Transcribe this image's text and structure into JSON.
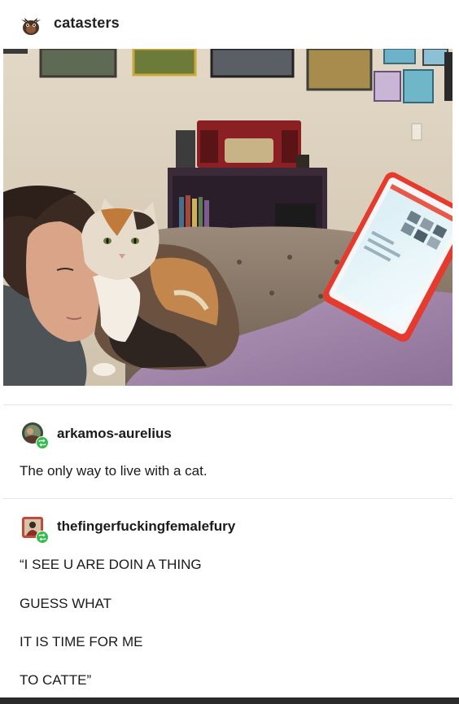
{
  "post": {
    "blog_name": "catasters",
    "blog_avatar_icon": "bat-creature-icon"
  },
  "reblogs": [
    {
      "username": "arkamos-aurelius",
      "avatar_icon": "user-avatar-icon",
      "badge_icon": "reblog-icon",
      "lines": [
        "The only way to live with a cat."
      ]
    },
    {
      "username": "thefingerfuckingfemalefury",
      "avatar_icon": "user-avatar-icon",
      "badge_icon": "reblog-icon",
      "lines": [
        "“I SEE U ARE DOIN A THING",
        "GUESS WHAT",
        "IT IS TIME FOR ME",
        "TO CATTE”"
      ]
    }
  ],
  "colors": {
    "badge_green": "#2fbf4a",
    "text": "#1a1a1a"
  }
}
